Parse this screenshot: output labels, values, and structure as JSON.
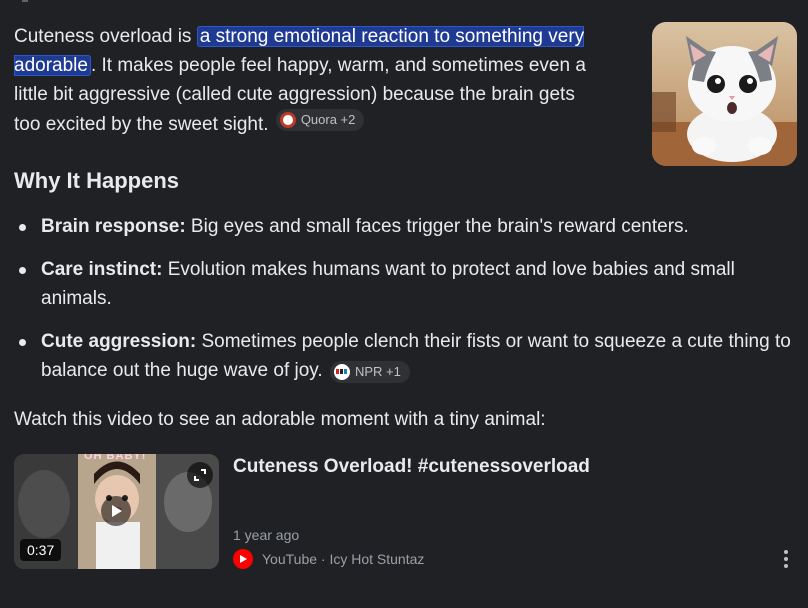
{
  "intro": {
    "lead": "Cuteness overload is ",
    "highlight": "a strong emotional reaction to something very adorable",
    "rest": ". It makes people feel happy, warm, and sometimes even a little bit aggressive (called cute aggression) because the brain gets too excited by the sweet sight. ",
    "source_chip": "Quora +2",
    "source_icon": "quora-icon"
  },
  "section": {
    "heading": "Why It Happens",
    "bullets": [
      {
        "term": "Brain response:",
        "text": " Big eyes and small faces trigger the brain's reward centers."
      },
      {
        "term": "Care instinct:",
        "text": " Evolution makes humans want to protect and love babies and small animals."
      },
      {
        "term": "Cute aggression:",
        "text": " Sometimes people clench their fists or want to squeeze a cute thing to balance out the huge wave of joy. ",
        "source_chip": "NPR +1",
        "source_icon": "npr-icon"
      }
    ]
  },
  "video_intro": "Watch this video to see an adorable moment with a tiny animal:",
  "video": {
    "title": "Cuteness Overload! #cutenessoverload",
    "duration": "0:37",
    "age": "1 year ago",
    "source": "YouTube · Icy Hot Stuntaz",
    "thumb_caption": "OH BABY!",
    "platform_icon": "youtube-icon"
  },
  "colors": {
    "background": "#202124",
    "text": "#e8eaed",
    "highlight_bg": "#1f3a93",
    "chip_bg": "#303134",
    "muted": "#9aa0a6",
    "youtube_red": "#ff0000"
  }
}
